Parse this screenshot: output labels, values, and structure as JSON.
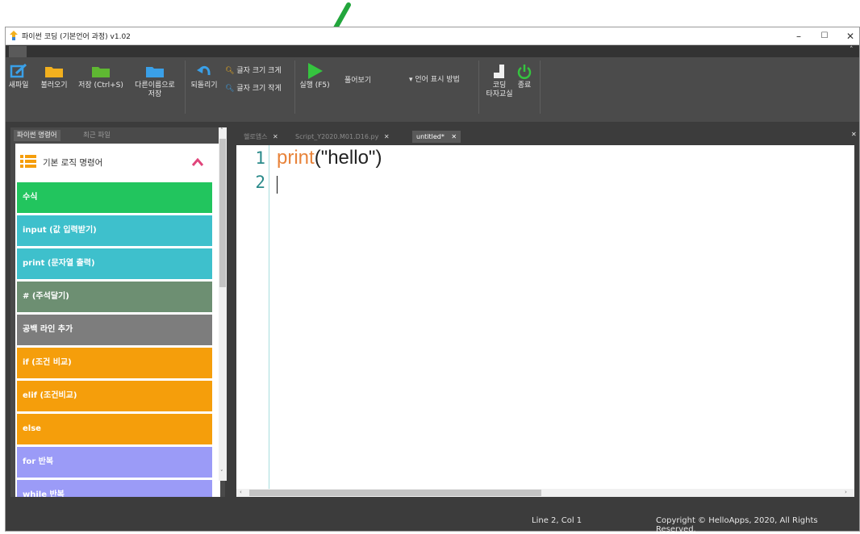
{
  "window": {
    "title": "파이썬 코딩 (기본언어 과정) v1.02",
    "controls": {
      "minimize": "–",
      "maximize": "☐",
      "close": "✕"
    }
  },
  "annotation": {
    "arrow_color": "#22a63c"
  },
  "ribbon": {
    "collapse": "˄",
    "new_file": "새파일",
    "open": "불러오기",
    "save": "저장 (Ctrl+S)",
    "save_as": "다른이름으로\n저장",
    "undo": "되돌리기",
    "font_bigger": "글자 크기 크게",
    "font_smaller": "글자 크기 작게",
    "run": "실행 (F5)",
    "font_dropdown": "풀어보기",
    "lang_display": "▾ 언어 표시 방법",
    "typing": "코딩\n타자교실",
    "exit": "종료"
  },
  "left_panel": {
    "tabs": [
      "파이썬 명령어",
      "최근 파일"
    ],
    "category": "기본 로직 명령어",
    "commands": [
      {
        "label": "수식",
        "color": "#22c55e"
      },
      {
        "label": "input (값 입력받기)",
        "color": "#3ec0cc"
      },
      {
        "label": "print (문자열 출력)",
        "color": "#3ec0cc"
      },
      {
        "label": "# (주석달기)",
        "color": "#6d8f72"
      },
      {
        "label": "공백 라인 추가",
        "color": "#7d7d7d"
      },
      {
        "label": "if (조건 비교)",
        "color": "#f59e0b"
      },
      {
        "label": "elif (조건비교)",
        "color": "#f59e0b"
      },
      {
        "label": "else",
        "color": "#f59e0b"
      },
      {
        "label": "for 반복",
        "color": "#9b9bf7"
      },
      {
        "label": "while 반복",
        "color": "#9b9bf7"
      }
    ]
  },
  "editor": {
    "tabs": [
      {
        "label": "헬로앱스",
        "close": "✕",
        "active": false
      },
      {
        "label": "Script_Y2020.M01.D16.py",
        "close": "✕",
        "active": false
      },
      {
        "label": "untitled*",
        "close": "✕",
        "active": true
      }
    ],
    "close_all": "✕",
    "lines": [
      {
        "num": "1",
        "func": "print",
        "open": "(",
        "str": "\"hello\"",
        "close": ")"
      },
      {
        "num": "2"
      }
    ]
  },
  "status": {
    "position": "Line 2, Col 1",
    "copyright": "Copyright © HelloApps, 2020, All Rights Reserved."
  }
}
